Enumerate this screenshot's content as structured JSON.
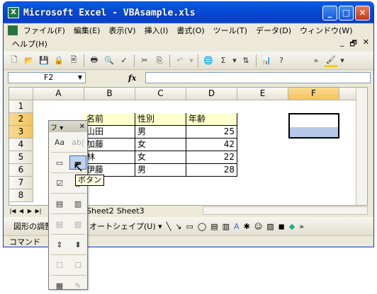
{
  "window": {
    "app_icon": "X",
    "title": "Microsoft Excel - VBAsample.xls",
    "minimize": "_",
    "maximize": "□",
    "close": "✕"
  },
  "menu": {
    "items": [
      "ファイル(F)",
      "編集(E)",
      "表示(V)",
      "挿入(I)",
      "書式(O)",
      "ツール(T)",
      "データ(D)",
      "ウィンドウ(W)"
    ],
    "help": "ヘルプ(H)",
    "mdi": [
      "_",
      "🗗",
      "✕"
    ]
  },
  "toolbar": {
    "icons": [
      "new-icon",
      "open-icon",
      "save-icon",
      "permission-icon",
      "print-preview-icon",
      "print-icon",
      "preview-icon",
      "spellcheck-icon",
      "cut-icon",
      "copy-icon",
      "undo-icon",
      "hyperlink-icon",
      "autosum-icon",
      "sort-icon",
      "chart-icon",
      "help-icon"
    ],
    "overflow": "»",
    "fill_color": "#f5d000"
  },
  "formula_bar": {
    "namebox_value": "F2",
    "fx_label": "fx",
    "content": ""
  },
  "grid": {
    "columns": [
      "A",
      "B",
      "C",
      "D",
      "E",
      "F"
    ],
    "selected_column": "F",
    "rows": [
      "1",
      "2",
      "3",
      "4",
      "5",
      "6",
      "7",
      "8"
    ],
    "selected_rows": [
      "2",
      "3"
    ],
    "header_row": [
      "名前",
      "性別",
      "年齢"
    ],
    "data_rows": [
      [
        "山田",
        "男",
        "25"
      ],
      [
        "加藤",
        "女",
        "42"
      ],
      [
        "林",
        "女",
        "22"
      ],
      [
        "伊藤",
        "男",
        "28"
      ]
    ],
    "header_fill": "#ffffcc",
    "selection_fill": "#b6c8e8"
  },
  "sheet_tabs": {
    "tabs": [
      "Sheet2",
      "Sheet3"
    ]
  },
  "drawing_toolbar": {
    "draw_label": "図形の調整",
    "autoshape_label": "オートシェイプ(U) ▾"
  },
  "status_bar": {
    "text": "コマンド"
  },
  "forms_toolbar": {
    "title": "フ",
    "dropdown": "▾",
    "close": "✕",
    "buttons": [
      {
        "icon": "label-icon",
        "glyph": "Aa",
        "disabled": false
      },
      {
        "icon": "editbox-icon",
        "glyph": "ab|",
        "disabled": true
      },
      {
        "icon": "groupbox-icon",
        "glyph": "▭",
        "disabled": false
      },
      {
        "icon": "button-icon",
        "glyph": "▬",
        "disabled": false
      },
      {
        "icon": "checkbox-icon",
        "glyph": "☑",
        "disabled": false
      },
      {
        "icon": "option-button-icon",
        "glyph": "◉",
        "disabled": false
      },
      {
        "icon": "listbox-icon",
        "glyph": "▤",
        "disabled": false
      },
      {
        "icon": "combobox-icon",
        "glyph": "▥",
        "disabled": false
      },
      {
        "icon": "combo-list-edit-icon",
        "glyph": "▤",
        "disabled": true
      },
      {
        "icon": "combo-dropdown-edit-icon",
        "glyph": "▥",
        "disabled": true
      },
      {
        "icon": "scrollbar-icon",
        "glyph": "⇕",
        "disabled": false
      },
      {
        "icon": "spinner-icon",
        "glyph": "⬍",
        "disabled": false
      },
      {
        "icon": "control-properties-icon",
        "glyph": "☐",
        "disabled": true
      },
      {
        "icon": "edit-code-icon",
        "glyph": "☐",
        "disabled": true
      },
      {
        "icon": "toggle-grid-icon",
        "glyph": "▦",
        "disabled": false
      },
      {
        "icon": "run-dialog-icon",
        "glyph": "✎",
        "disabled": true
      }
    ]
  },
  "tooltip": {
    "text": "ボタン"
  }
}
